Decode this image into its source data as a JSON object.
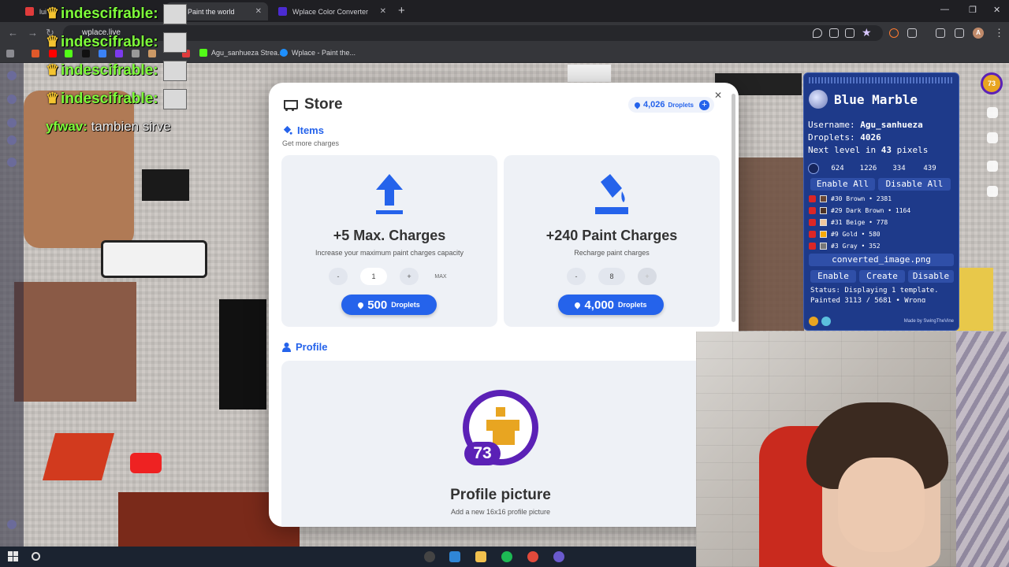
{
  "browser": {
    "tabs": [
      {
        "label": "lui",
        "active": false
      },
      {
        "label": "Paint the world",
        "active": true
      },
      {
        "label": "Wplace Color Converter",
        "active": false
      }
    ],
    "url": "wplace.live",
    "bookmarks": [
      "Agu_sanhueza Strea...",
      "Wplace - Paint the..."
    ]
  },
  "chat": {
    "lines": [
      {
        "user": "indescifrable:",
        "msg": ""
      },
      {
        "user": "indescifrable:",
        "msg": ""
      },
      {
        "user": "indescifrable:",
        "msg": ""
      },
      {
        "user": "indescifrable:",
        "msg": ""
      },
      {
        "user": "yfwav:",
        "msg": "tambien sirve"
      }
    ]
  },
  "store": {
    "title": "Store",
    "balance": "4,026",
    "balance_unit": "Droplets",
    "items_title": "Items",
    "items_sub": "Get more charges",
    "cards": [
      {
        "title": "+5 Max. Charges",
        "desc": "Increase your maximum paint charges capacity",
        "minus": "-",
        "qty": "1",
        "plus": "+",
        "max": "MAX",
        "price": "500",
        "unit": "Droplets"
      },
      {
        "title": "+240 Paint Charges",
        "desc": "Recharge paint charges",
        "minus": "-",
        "qty": "8",
        "plus": "+",
        "max": "",
        "price": "4,000",
        "unit": "Droplets"
      }
    ],
    "profile_title": "Profile",
    "profile_card": {
      "level": "73",
      "title": "Profile picture",
      "desc": "Add a new 16x16 profile picture"
    }
  },
  "blue_marble": {
    "title": "Blue Marble",
    "username_label": "Username:",
    "username": "Agu_sanhueza",
    "droplets_label": "Droplets:",
    "droplets": "4026",
    "next_level_pre": "Next level in",
    "next_level_num": "43",
    "next_level_post": "pixels",
    "coords": [
      "624",
      "1226",
      "334",
      "439"
    ],
    "enable_all": "Enable All",
    "disable_all": "Disable All",
    "colors": [
      {
        "label": "#30 Brown • 2381",
        "swatch": "#684634"
      },
      {
        "label": "#29 Dark Brown • 1164",
        "swatch": "#4c3226"
      },
      {
        "label": "#31 Beige • 778",
        "swatch": "#f1c89e"
      },
      {
        "label": "#9 Gold • 580",
        "swatch": "#f6aa09"
      },
      {
        "label": "#3 Gray • 352",
        "swatch": "#787878"
      }
    ],
    "file": "converted_image.png",
    "enable": "Enable",
    "create": "Create",
    "disable": "Disable",
    "status": "Status: Displaying 1 template.",
    "status2": "Painted 3113 / 5681 • Wrong",
    "made_by": "Made by SwingTheVine"
  },
  "level_badge": "73",
  "colors": {
    "accent": "#2563eb",
    "panel": "#1e3a8a",
    "profile_ring": "#5b21b6",
    "gold": "#e8a521"
  }
}
